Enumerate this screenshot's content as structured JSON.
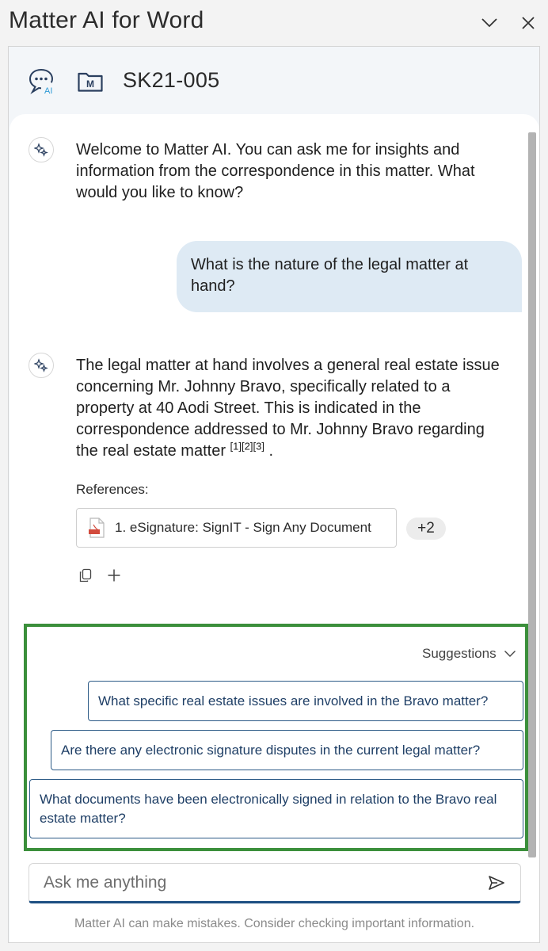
{
  "window": {
    "title": "Matter AI for Word",
    "chevron_icon": "chevron-down-icon",
    "close_icon": "close-icon"
  },
  "header": {
    "ai_badge": "AI",
    "matter_icon_letter": "M",
    "matter_id": "SK21-005"
  },
  "conversation": {
    "welcome": "Welcome to Matter AI. You can ask me for insights and information from the correspondence in this matter. What would you like to know?",
    "user_question": "What is the nature of the legal matter at hand?",
    "answer_lines": [
      "The legal matter at hand involves a general real estate issue",
      "concerning Mr. Johnny Bravo, specifically related to a",
      "property at 40 Aodi Street. This is indicated in the",
      "correspondence addressed to Mr. Johnny Bravo regarding",
      "the real estate matter"
    ],
    "citations": [
      "[1]",
      "[2]",
      "[3]"
    ],
    "answer_end": ".",
    "references_label": "References:",
    "reference_1": "1. eSignature: SignIT - Sign Any Document",
    "more_references": "+2"
  },
  "suggestions": {
    "toggle_label": "Suggestions",
    "items": [
      "What specific real estate issues are involved in the Bravo matter?",
      "Are there any electronic signature disputes in the current legal matter?",
      "What documents have been electronically signed in relation to the Bravo real estate matter?"
    ]
  },
  "composer": {
    "placeholder": "Ask me anything",
    "disclaimer": "Matter AI can make mistakes. Consider checking important information."
  },
  "colors": {
    "user_bubble": "#deeaf4",
    "suggestion_border": "#2c5a86",
    "highlight_frame": "#3b8f3b",
    "input_underline": "#1d4f82",
    "logo_accent": "#2f9bd6"
  }
}
